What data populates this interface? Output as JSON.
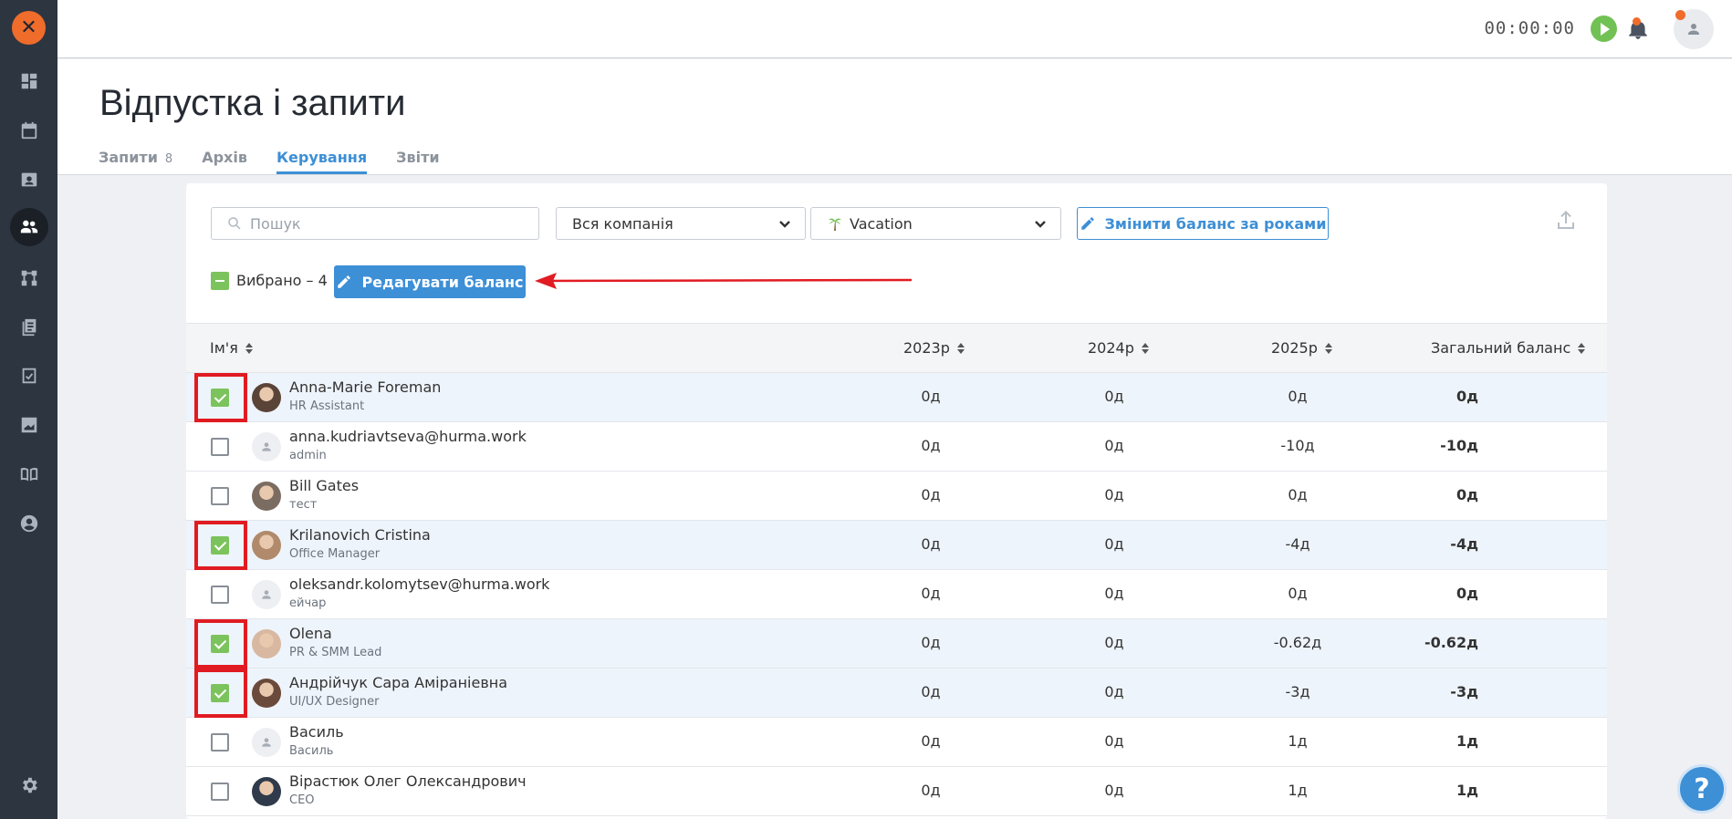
{
  "app": {
    "title": "Відпустка і запити",
    "timer": "00:00:00"
  },
  "sidebar": {
    "items": [
      {
        "name": "dashboard-icon"
      },
      {
        "name": "calendar-icon"
      },
      {
        "name": "id-card-icon"
      },
      {
        "name": "people-icon",
        "active": true
      },
      {
        "name": "structure-icon"
      },
      {
        "name": "docs-icon"
      },
      {
        "name": "tasks-icon"
      },
      {
        "name": "reports-icon"
      },
      {
        "name": "book-icon"
      },
      {
        "name": "profile-icon"
      }
    ],
    "settings": "gear-icon"
  },
  "tabs": [
    {
      "label": "Запити",
      "count": "8"
    },
    {
      "label": "Архів"
    },
    {
      "label": "Керування",
      "active": true
    },
    {
      "label": "Звіти"
    }
  ],
  "filters": {
    "search_placeholder": "Пошук",
    "company": "Вся компанія",
    "leave_type": "Vacation",
    "change_balance_button": "Змінити баланс за роками"
  },
  "selection": {
    "selected_label": "Вибрано – 4",
    "edit_balance_button": "Редагувати баланс"
  },
  "table": {
    "headers": {
      "name": "Ім'я",
      "y2023": "2023р",
      "y2024": "2024р",
      "y2025": "2025р",
      "total": "Загальний баланс"
    },
    "rows": [
      {
        "name": "Anna-Marie Foreman",
        "role": "HR Assistant",
        "y2023": "0д",
        "y2024": "0д",
        "y2025": "0д",
        "total": "0д",
        "checked": true
      },
      {
        "name": "anna.kudriavtseva@hurma.work",
        "role": "admin",
        "y2023": "0д",
        "y2024": "0д",
        "y2025": "-10д",
        "total": "-10д",
        "checked": false
      },
      {
        "name": "Bill Gates",
        "role": "тест",
        "y2023": "0д",
        "y2024": "0д",
        "y2025": "0д",
        "total": "0д",
        "checked": false
      },
      {
        "name": "Krilanovich Cristina",
        "role": "Office Manager",
        "y2023": "0д",
        "y2024": "0д",
        "y2025": "-4д",
        "total": "-4д",
        "checked": true
      },
      {
        "name": "oleksandr.kolomytsev@hurma.work",
        "role": "ейчар",
        "y2023": "0д",
        "y2024": "0д",
        "y2025": "0д",
        "total": "0д",
        "checked": false
      },
      {
        "name": "Olena",
        "role": "PR & SMM Lead",
        "y2023": "0д",
        "y2024": "0д",
        "y2025": "-0.62д",
        "total": "-0.62д",
        "checked": true
      },
      {
        "name": "Андрійчук Сара Аміраніевна",
        "role": "UI/UX Designer",
        "y2023": "0д",
        "y2024": "0д",
        "y2025": "-3д",
        "total": "-3д",
        "checked": true
      },
      {
        "name": "Василь",
        "role": "Василь",
        "y2023": "0д",
        "y2024": "0д",
        "y2025": "1д",
        "total": "1д",
        "checked": false
      },
      {
        "name": "Вірастюк Олег Олександрович",
        "role": "CEO",
        "y2023": "0д",
        "y2024": "0д",
        "y2025": "1д",
        "total": "1д",
        "checked": false
      }
    ]
  },
  "colors": {
    "accent": "#3d8fd6",
    "check": "#7cc35d",
    "highlight": "#e11b22",
    "sidebar": "#2d3540",
    "brand": "#ef6c2b"
  }
}
